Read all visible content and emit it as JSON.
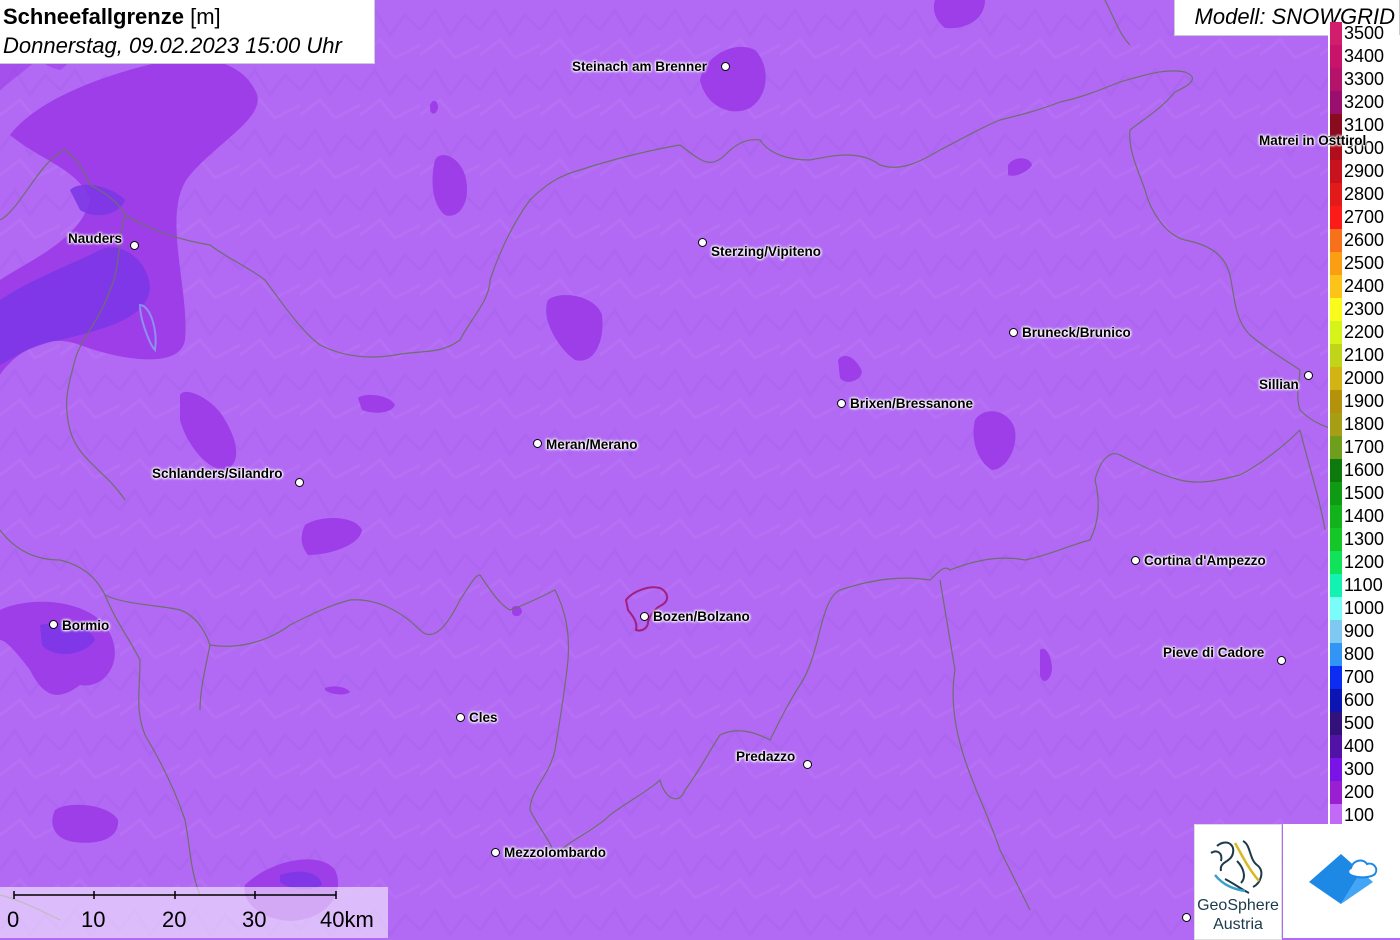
{
  "title": {
    "variable": "Schneefallgrenze",
    "unit": "[m]",
    "datetime": "Donnerstag, 09.02.2023 15:00 Uhr"
  },
  "model": "Modell: SNOWGRID",
  "colors": {
    "base_fill": "#b26af4",
    "patch_fill": "#9d3ee8",
    "deep_patch": "#7b36e6",
    "border_line": "#6e6e6e"
  },
  "legend": {
    "entries": [
      {
        "label": "3500",
        "color": "#d11d6b"
      },
      {
        "label": "3400",
        "color": "#c9136b"
      },
      {
        "label": "3300",
        "color": "#b5136b"
      },
      {
        "label": "3200",
        "color": "#9a0e6e"
      },
      {
        "label": "3100",
        "color": "#8a0a1e"
      },
      {
        "label": "3000",
        "color": "#b10d1c"
      },
      {
        "label": "2900",
        "color": "#c8121e"
      },
      {
        "label": "2800",
        "color": "#e21a1a"
      },
      {
        "label": "2700",
        "color": "#fb1c1a"
      },
      {
        "label": "2600",
        "color": "#f7711c"
      },
      {
        "label": "2500",
        "color": "#fb9e14"
      },
      {
        "label": "2400",
        "color": "#fcc418"
      },
      {
        "label": "2300",
        "color": "#fafb1c"
      },
      {
        "label": "2200",
        "color": "#d6f41c"
      },
      {
        "label": "2100",
        "color": "#c1d41a"
      },
      {
        "label": "2000",
        "color": "#d2b414"
      },
      {
        "label": "1900",
        "color": "#b5920c"
      },
      {
        "label": "1800",
        "color": "#a69e14"
      },
      {
        "label": "1700",
        "color": "#6e9e1c"
      },
      {
        "label": "1600",
        "color": "#0e7a0e"
      },
      {
        "label": "1500",
        "color": "#0f9a14"
      },
      {
        "label": "1400",
        "color": "#12b21c"
      },
      {
        "label": "1300",
        "color": "#14c626"
      },
      {
        "label": "1200",
        "color": "#10e35a"
      },
      {
        "label": "1100",
        "color": "#13f2b0"
      },
      {
        "label": "1000",
        "color": "#7afcf9"
      },
      {
        "label": "900",
        "color": "#7ec8f2"
      },
      {
        "label": "800",
        "color": "#3294f5"
      },
      {
        "label": "700",
        "color": "#0c2cf2"
      },
      {
        "label": "600",
        "color": "#0c14b2"
      },
      {
        "label": "500",
        "color": "#32127a"
      },
      {
        "label": "400",
        "color": "#5212a6"
      },
      {
        "label": "300",
        "color": "#7a14e6"
      },
      {
        "label": "200",
        "color": "#9a1ed2"
      },
      {
        "label": "100",
        "color": "#c06af5"
      }
    ]
  },
  "places": [
    {
      "name": "Steinach am Brenner"
    },
    {
      "name": "Nauders"
    },
    {
      "name": "Sterzing/Vipiteno"
    },
    {
      "name": "Matrei in Osttirol"
    },
    {
      "name": "Bruneck/Brunico"
    },
    {
      "name": "Sillian"
    },
    {
      "name": "Brixen/Bressanone"
    },
    {
      "name": "Meran/Merano"
    },
    {
      "name": "Schlanders/Silandro"
    },
    {
      "name": "Cortina d'Ampezzo"
    },
    {
      "name": "Bozen/Bolzano"
    },
    {
      "name": "Bormio"
    },
    {
      "name": "Pieve di Cadore"
    },
    {
      "name": "Cles"
    },
    {
      "name": "Predazzo"
    },
    {
      "name": "Mezzolombardo"
    }
  ],
  "scalebar": {
    "ticks": [
      "0",
      "10",
      "20",
      "30"
    ],
    "end_label": "40km"
  },
  "logos": {
    "geosphere_line1": "GeoSphere",
    "geosphere_line2": "Austria"
  }
}
